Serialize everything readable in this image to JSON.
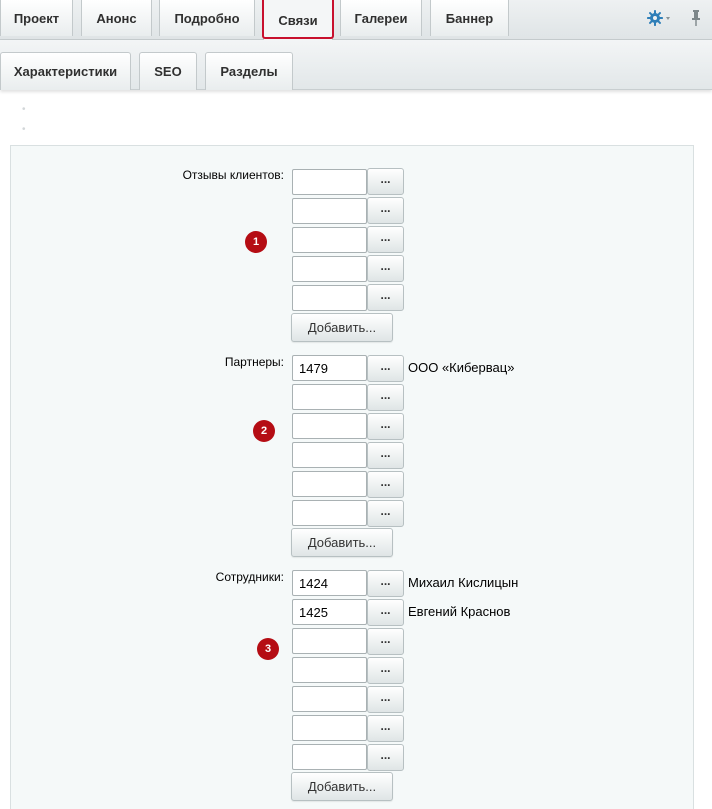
{
  "tabs_top": [
    {
      "label": "Проект"
    },
    {
      "label": "Анонс"
    },
    {
      "label": "Подробно"
    },
    {
      "label": "Связи"
    },
    {
      "label": "Галереи"
    },
    {
      "label": "Баннер"
    }
  ],
  "tabs_second": [
    {
      "label": "Характеристики"
    },
    {
      "label": "SEO"
    },
    {
      "label": "Разделы"
    }
  ],
  "active_tab": "Связи",
  "picker_label": "...",
  "add_label": "Добавить...",
  "groups": [
    {
      "label": "Отзывы клиентов:",
      "badge": "1",
      "rows": [
        {
          "value": "",
          "resolved": ""
        },
        {
          "value": "",
          "resolved": ""
        },
        {
          "value": "",
          "resolved": ""
        },
        {
          "value": "",
          "resolved": ""
        },
        {
          "value": "",
          "resolved": ""
        }
      ]
    },
    {
      "label": "Партнеры:",
      "badge": "2",
      "rows": [
        {
          "value": "1479",
          "resolved": "ООО «Кибервац»"
        },
        {
          "value": "",
          "resolved": ""
        },
        {
          "value": "",
          "resolved": ""
        },
        {
          "value": "",
          "resolved": ""
        },
        {
          "value": "",
          "resolved": ""
        },
        {
          "value": "",
          "resolved": ""
        }
      ]
    },
    {
      "label": "Сотрудники:",
      "badge": "3",
      "rows": [
        {
          "value": "1424",
          "resolved": "Михаил Кислицын"
        },
        {
          "value": "1425",
          "resolved": "Евгений Краснов"
        },
        {
          "value": "",
          "resolved": ""
        },
        {
          "value": "",
          "resolved": ""
        },
        {
          "value": "",
          "resolved": ""
        },
        {
          "value": "",
          "resolved": ""
        },
        {
          "value": "",
          "resolved": ""
        }
      ]
    }
  ],
  "colors": {
    "active_outline": "#c8102e",
    "badge": "#b50d14",
    "gear": "#2f7fb8"
  }
}
